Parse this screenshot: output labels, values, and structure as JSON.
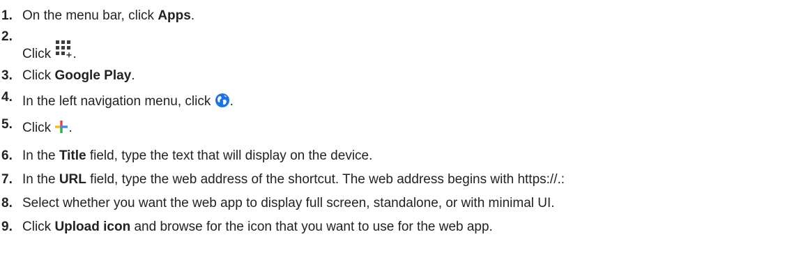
{
  "steps": [
    {
      "num": "1.",
      "pre": "On the menu bar, click ",
      "bold": "Apps",
      "post": "."
    },
    {
      "num": "2.",
      "pre": "Click ",
      "icon": "app-grid-add-icon",
      "post": "."
    },
    {
      "num": "3.",
      "pre": "Click ",
      "bold": "Google Play",
      "post": "."
    },
    {
      "num": "4.",
      "pre": "In the left navigation menu, click ",
      "icon": "globe-icon",
      "post": "."
    },
    {
      "num": "5.",
      "pre": "Click ",
      "icon": "plus-icon",
      "post": "."
    },
    {
      "num": "6.",
      "pre": "In the ",
      "bold": "Title",
      "post": " field, type the text that will display on the device."
    },
    {
      "num": "7.",
      "pre": "In the ",
      "bold": "URL",
      "post": " field, type the web address of the shortcut. The web address begins with https://.:"
    },
    {
      "num": "8.",
      "pre": "Select whether you want the web app to display full screen, standalone, or with minimal UI."
    },
    {
      "num": "9.",
      "pre": "Click ",
      "bold": "Upload icon",
      "post": " and browse for the icon that you want to use for the web app."
    }
  ],
  "colors": {
    "text": "#222222",
    "globe": "#1a73e8",
    "plus_blue": "#4285f4",
    "plus_red": "#ea4335",
    "plus_yellow": "#fbbc04",
    "plus_green": "#34a853"
  }
}
